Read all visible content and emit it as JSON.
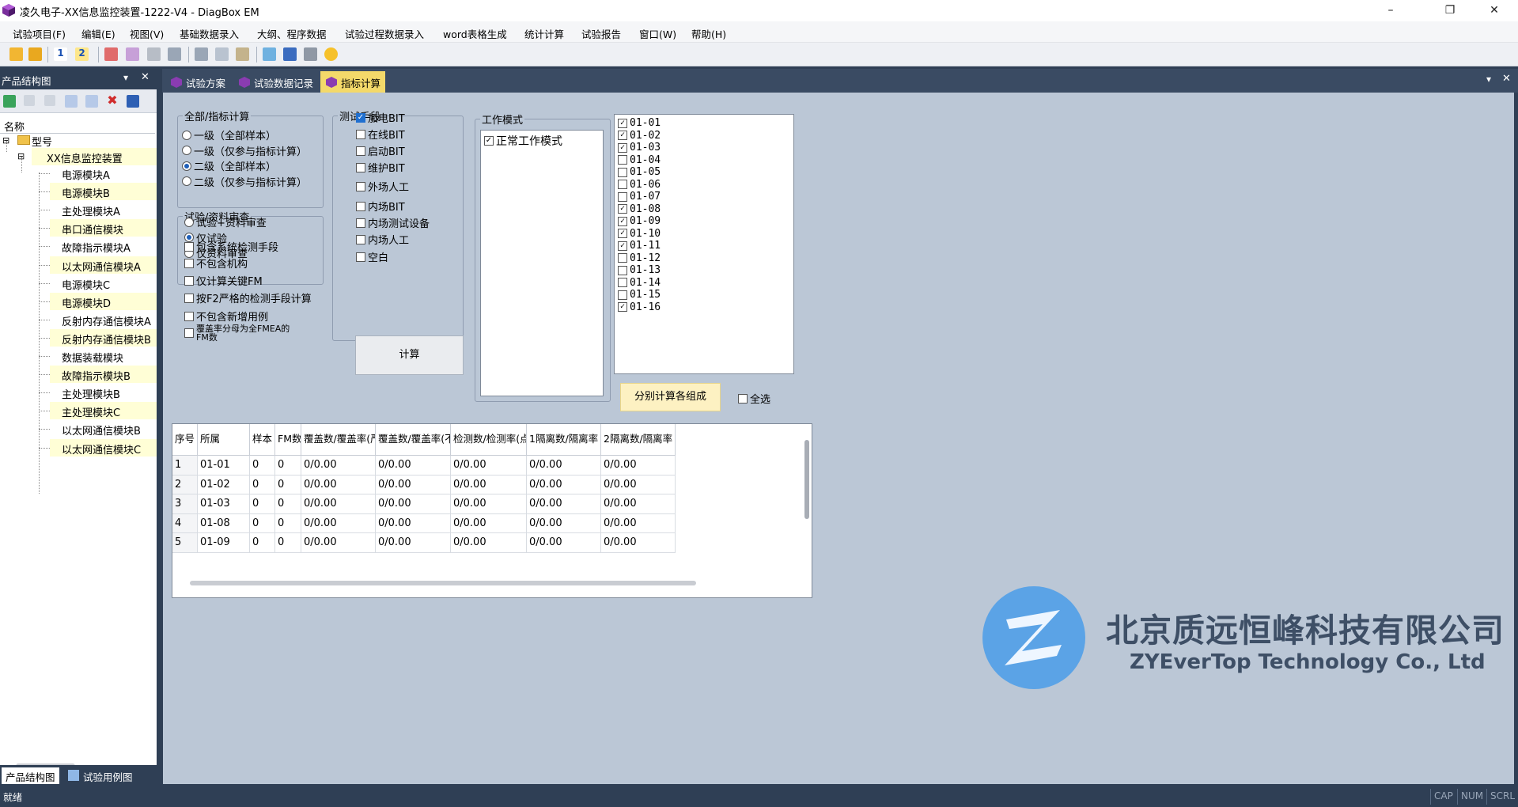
{
  "window": {
    "title": "凌久电子-XX信息监控装置-1222-V4 - DiagBox EM",
    "minimize": "–",
    "restore": "❐",
    "close": "✕"
  },
  "menu": [
    "试验项目(F)",
    "编辑(E)",
    "视图(V)",
    "基础数据录入",
    "大纲、程序数据",
    "试验过程数据录入",
    "word表格生成",
    "统计计算",
    "试验报告",
    "窗口(W)",
    "帮助(H)"
  ],
  "left_panel": {
    "title": "产品结构图",
    "column_header": "名称",
    "root": "型号",
    "device": "XX信息监控装置",
    "modules": [
      "电源模块A",
      "电源模块B",
      "主处理模块A",
      "串口通信模块",
      "故障指示模块A",
      "以太网通信模块A",
      "电源模块C",
      "电源模块D",
      "反射内存通信模块A",
      "反射内存通信模块B",
      "数据装载模块",
      "故障指示模块B",
      "主处理模块B",
      "主处理模块C",
      "以太网通信模块B",
      "以太网通信模块C"
    ],
    "bottom_tabs": [
      "产品结构图",
      "试验用例图"
    ]
  },
  "status": {
    "text": "就绪",
    "keys": [
      "CAP",
      "NUM",
      "SCRL"
    ]
  },
  "doc_tabs": [
    "试验方案",
    "试验数据记录",
    "指标计算"
  ],
  "calc": {
    "group_level": {
      "title": "全部/指标计算",
      "options": [
        "一级（全部样本）",
        "一级（仅参与指标计算）",
        "二级（全部样本）",
        "二级（仅参与指标计算）"
      ],
      "selected": 2
    },
    "group_review": {
      "title": "试验/资料审查",
      "options": [
        "试验+资料审查",
        "仅试验",
        "仅资料审查"
      ],
      "selected": 1
    },
    "extra_options": [
      "包含系统检测手段",
      "不包含机构",
      "仅计算关键FM",
      "按F2严格的检测手段计算",
      "不包含新增用例",
      "覆盖率分母为全FMEA的FM数"
    ],
    "group_test": {
      "title": "测试手段",
      "options": [
        "加电BIT",
        "在线BIT",
        "启动BIT",
        "维护BIT",
        "外场人工",
        "内场BIT",
        "内场测试设备",
        "内场人工",
        "空白"
      ],
      "checked": [
        true,
        false,
        false,
        false,
        false,
        false,
        false,
        false,
        false
      ]
    },
    "calc_button": "计算",
    "group_mode": {
      "title": "工作模式",
      "items": [
        "正常工作模式"
      ]
    },
    "items": [
      {
        "id": "01-01",
        "checked": true
      },
      {
        "id": "01-02",
        "checked": true
      },
      {
        "id": "01-03",
        "checked": true
      },
      {
        "id": "01-04",
        "checked": false
      },
      {
        "id": "01-05",
        "checked": false
      },
      {
        "id": "01-06",
        "checked": false
      },
      {
        "id": "01-07",
        "checked": false
      },
      {
        "id": "01-08",
        "checked": true
      },
      {
        "id": "01-09",
        "checked": true
      },
      {
        "id": "01-10",
        "checked": true
      },
      {
        "id": "01-11",
        "checked": true
      },
      {
        "id": "01-12",
        "checked": false
      },
      {
        "id": "01-13",
        "checked": false
      },
      {
        "id": "01-14",
        "checked": false
      },
      {
        "id": "01-15",
        "checked": false
      },
      {
        "id": "01-16",
        "checked": true
      }
    ],
    "split_button": "分别计算各组成",
    "select_all": "全选",
    "table": {
      "headers": [
        "序号",
        "所属",
        "样本",
        "FM数",
        "覆盖数/覆盖率(严",
        "覆盖数/覆盖率(不",
        "检测数/检测率(点",
        "1隔离数/隔离率",
        "2隔离数/隔离率"
      ],
      "rows": [
        [
          "1",
          "01-01",
          "0",
          "0",
          "0/0.00",
          "0/0.00",
          "0/0.00",
          "0/0.00",
          "0/0.00"
        ],
        [
          "2",
          "01-02",
          "0",
          "0",
          "0/0.00",
          "0/0.00",
          "0/0.00",
          "0/0.00",
          "0/0.00"
        ],
        [
          "3",
          "01-03",
          "0",
          "0",
          "0/0.00",
          "0/0.00",
          "0/0.00",
          "0/0.00",
          "0/0.00"
        ],
        [
          "4",
          "01-08",
          "0",
          "0",
          "0/0.00",
          "0/0.00",
          "0/0.00",
          "0/0.00",
          "0/0.00"
        ],
        [
          "5",
          "01-09",
          "0",
          "0",
          "0/0.00",
          "0/0.00",
          "0/0.00",
          "0/0.00",
          "0/0.00"
        ]
      ]
    }
  },
  "watermark": {
    "cn": "北京质远恒峰科技有限公司",
    "en": "ZYEverTop Technology Co., Ltd"
  },
  "colors": {
    "frame": "#2f3f55",
    "panel": "#bbc7d6",
    "active_tab": "#f3d96a",
    "logo": "#5ba3e6"
  }
}
